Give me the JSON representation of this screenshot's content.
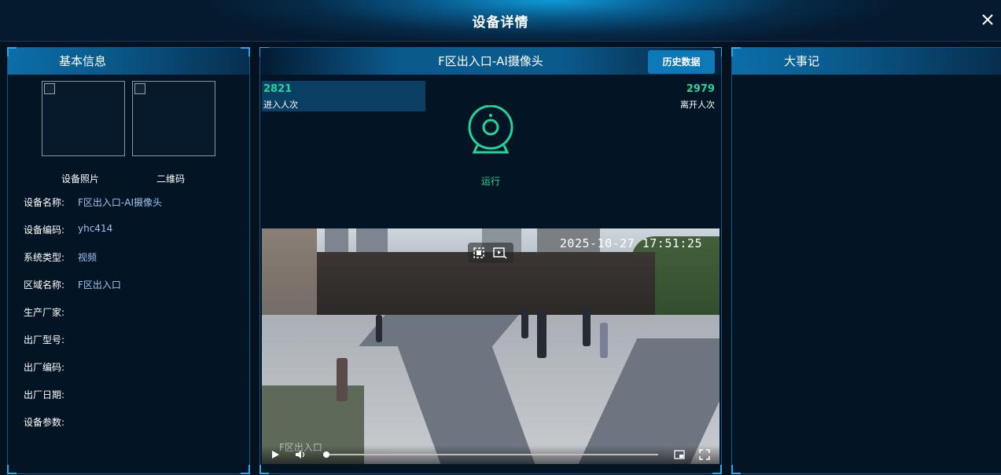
{
  "window": {
    "title": "设备详情"
  },
  "left_panel": {
    "title": "基本信息",
    "photo_caption": "设备照片",
    "qr_caption": "二维码",
    "fields": [
      {
        "label": "设备名称:",
        "value": "F区出入口-AI摄像头"
      },
      {
        "label": "设备编码:",
        "value": "yhc414"
      },
      {
        "label": "系统类型:",
        "value": "视频"
      },
      {
        "label": "区域名称:",
        "value": "F区出入口"
      },
      {
        "label": "生产厂家:",
        "value": ""
      },
      {
        "label": "出厂型号:",
        "value": ""
      },
      {
        "label": "出厂编码:",
        "value": ""
      },
      {
        "label": "出厂日期:",
        "value": ""
      },
      {
        "label": "设备参数:",
        "value": ""
      }
    ]
  },
  "center_panel": {
    "title": "F区出入口-AI摄像头",
    "history_button": "历史数据",
    "enter": {
      "count": "2821",
      "label": "进入人次"
    },
    "leave": {
      "count": "2979",
      "label": "离开人次"
    },
    "status_icon": "webcam-icon",
    "status_text": "运行",
    "video": {
      "timestamp": "2025-10-27 17:51:25",
      "overlay_label": "F区出入口",
      "progress": 0.01
    }
  },
  "right_panel": {
    "title": "大事记"
  },
  "colors": {
    "accent": "#0d79b8",
    "ok": "#21d49a",
    "value_text": "#9fc3ee"
  }
}
